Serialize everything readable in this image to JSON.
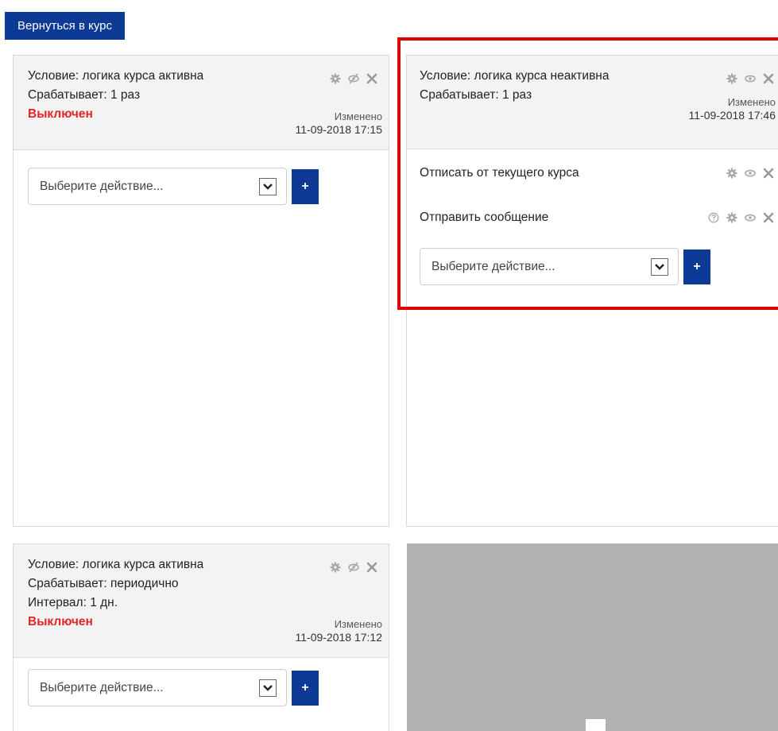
{
  "back_button": {
    "label": "Вернуться в курс"
  },
  "cards": [
    {
      "condition": "Условие: логика курса активна",
      "trigger": "Срабатывает: 1 раз",
      "status": "Выключен",
      "modified_label": "Изменено",
      "modified_date": "11-09-2018 17:15",
      "select_placeholder": "Выберите действие...",
      "add_label": "+"
    },
    {
      "condition": "Условие: логика курса неактивна",
      "trigger": "Срабатывает: 1 раз",
      "modified_label": "Изменено",
      "modified_date": "11-09-2018 17:46",
      "actions": [
        {
          "label": "Отписать от текущего курса"
        },
        {
          "label": "Отправить сообщение"
        }
      ],
      "select_placeholder": "Выберите действие...",
      "add_label": "+"
    },
    {
      "condition": "Условие: логика курса активна",
      "trigger": "Срабатывает: периодично",
      "interval": "Интервал: 1 дн.",
      "status": "Выключен",
      "modified_label": "Изменено",
      "modified_date": "11-09-2018 17:12",
      "select_placeholder": "Выберите действие...",
      "add_label": "+"
    }
  ],
  "colors": {
    "accent": "#0c3a94",
    "status_off": "#e32424",
    "highlight": "#e00000",
    "header_bg": "#f3f3f3",
    "placeholder_block": "#b1b1b1"
  }
}
